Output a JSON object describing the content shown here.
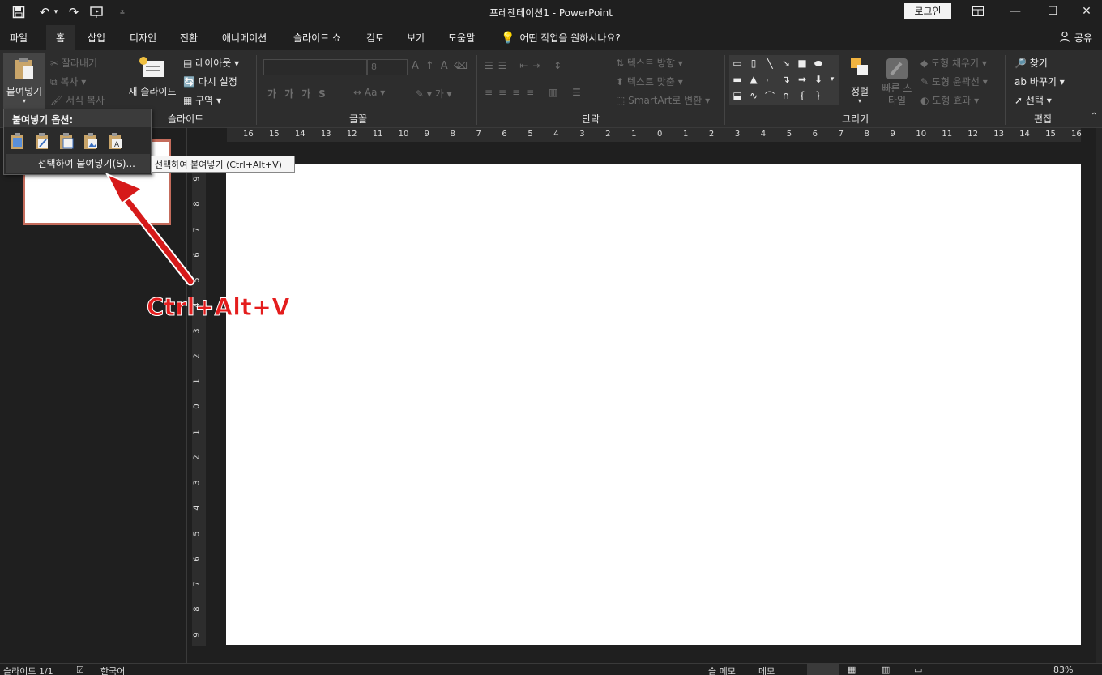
{
  "window": {
    "title": "프레젠테이션1  -  PowerPoint",
    "login_label": "로그인"
  },
  "menu": {
    "tabs": [
      "파일",
      "홈",
      "삽입",
      "디자인",
      "전환",
      "애니메이션",
      "슬라이드 쇼",
      "검토",
      "보기",
      "도움말"
    ],
    "active_tab": "홈",
    "tell_me": "어떤 작업을 원하시나요?",
    "share": "공유"
  },
  "ribbon": {
    "clipboard": {
      "paste": "붙여넣기",
      "cut": "잘라내기",
      "copy": "복사",
      "format_painter": "서식 복사"
    },
    "slides": {
      "label": "슬라이드",
      "new_slide": "새 슬라이드",
      "layout": "레이아웃",
      "reset": "다시 설정",
      "section": "구역"
    },
    "font": {
      "label": "글꼴",
      "size": "8"
    },
    "paragraph": {
      "label": "단락",
      "text_direction": "텍스트 방향",
      "align_text": "텍스트 맞춤",
      "smartart": "SmartArt로 변환"
    },
    "drawing": {
      "label": "그리기",
      "arrange": "정렬",
      "quick_styles": "빠른 스타일",
      "fill": "도형 채우기",
      "outline": "도형 윤곽선",
      "effects": "도형 효과"
    },
    "editing": {
      "label": "편집",
      "find": "찾기",
      "replace": "바꾸기",
      "select": "선택"
    }
  },
  "paste_menu": {
    "title": "붙여넣기 옵션:",
    "paste_special": "선택하여 붙여넣기(S)...",
    "tooltip": "선택하여 붙여넣기 (Ctrl+Alt+V)"
  },
  "annotation": {
    "text": "Ctrl+Alt+V",
    "color": "#e41d1d"
  },
  "rulers": {
    "horizontal": [
      "16",
      "15",
      "14",
      "13",
      "12",
      "11",
      "10",
      "9",
      "8",
      "7",
      "6",
      "5",
      "4",
      "3",
      "2",
      "1",
      "0",
      "1",
      "2",
      "3",
      "4",
      "5",
      "6",
      "7",
      "8",
      "9",
      "10",
      "11",
      "12",
      "13",
      "14",
      "15",
      "16"
    ],
    "vertical": [
      "9",
      "8",
      "7",
      "6",
      "5",
      "4",
      "3",
      "2",
      "1",
      "0",
      "1",
      "2",
      "3",
      "4",
      "5",
      "6",
      "7",
      "8",
      "9"
    ]
  },
  "statusbar": {
    "slide": "슬라이드 1/1",
    "language": "한국어",
    "notes": "슬 메모",
    "comments": "메모",
    "zoom": "83%"
  },
  "colors": {
    "accent": "#c56c5c",
    "background": "#1f1f1f",
    "ribbon": "#2d2d2d"
  }
}
